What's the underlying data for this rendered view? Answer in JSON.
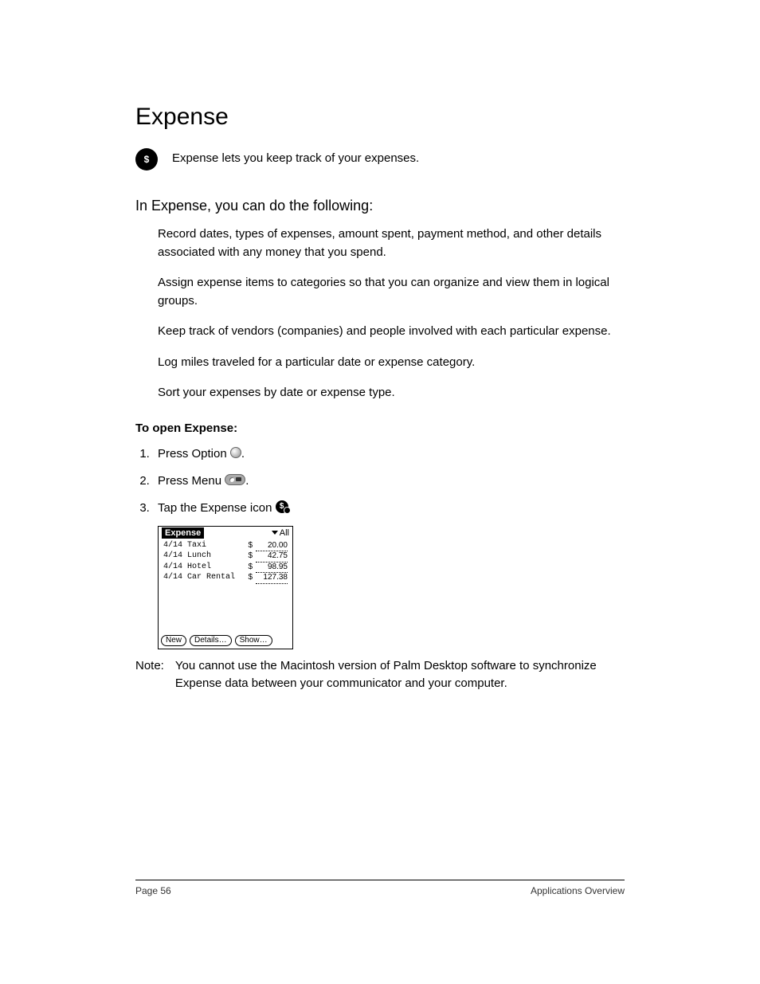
{
  "title": "Expense",
  "intro": "Expense lets you keep track of your expenses.",
  "subhead": "In Expense, you can do the following:",
  "features": [
    "Record dates, types of expenses, amount spent, payment method, and other details associated with any money that you spend.",
    "Assign expense items to categories so that you can organize and view them in logical groups.",
    "Keep track of vendors (companies) and people involved with each particular expense.",
    "Log miles traveled for a particular date or expense category.",
    "Sort your expenses by date or expense type."
  ],
  "procHead": "To open Expense:",
  "steps": {
    "s1a": "Press Option ",
    "s1b": ".",
    "s2a": "Press Menu ",
    "s2b": ".",
    "s3a": "Tap the Expense icon ",
    "s3b": "."
  },
  "palm": {
    "title": "Expense",
    "category": "All",
    "rows": [
      {
        "date": "4/14",
        "desc": "Taxi",
        "cur": "$",
        "amount": "20.00"
      },
      {
        "date": "4/14",
        "desc": "Lunch",
        "cur": "$",
        "amount": "42.75"
      },
      {
        "date": "4/14",
        "desc": "Hotel",
        "cur": "$",
        "amount": "98.95"
      },
      {
        "date": "4/14",
        "desc": "Car Rental",
        "cur": "$",
        "amount": "127.38"
      }
    ],
    "buttons": {
      "new": "New",
      "details": "Details…",
      "show": "Show…"
    }
  },
  "note": {
    "label": "Note:",
    "text": "You cannot use the Macintosh version of Palm Desktop software to synchronize Expense data between your communicator and your computer."
  },
  "footer": {
    "left": "Page 56",
    "right": "Applications Overview"
  }
}
